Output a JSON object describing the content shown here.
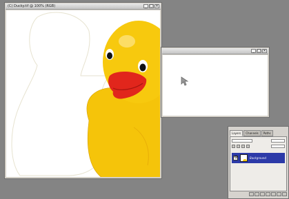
{
  "duck_document": {
    "title": "(C) Ducky.tif @ 100% (RGB)",
    "window_buttons": [
      "_",
      "□",
      "×"
    ]
  },
  "blank_document": {
    "window_buttons": [
      "_",
      "□",
      "×"
    ]
  },
  "layers_panel": {
    "tabs": [
      "Layers",
      "Channels",
      "Paths"
    ],
    "layer_name": "Background",
    "eye_glyph": "👁"
  },
  "colors": {
    "workspace": "#848484",
    "duck_yellow": "#f7c60a",
    "beak_red": "#e1261c",
    "layer_selected": "#2c3aa8"
  }
}
